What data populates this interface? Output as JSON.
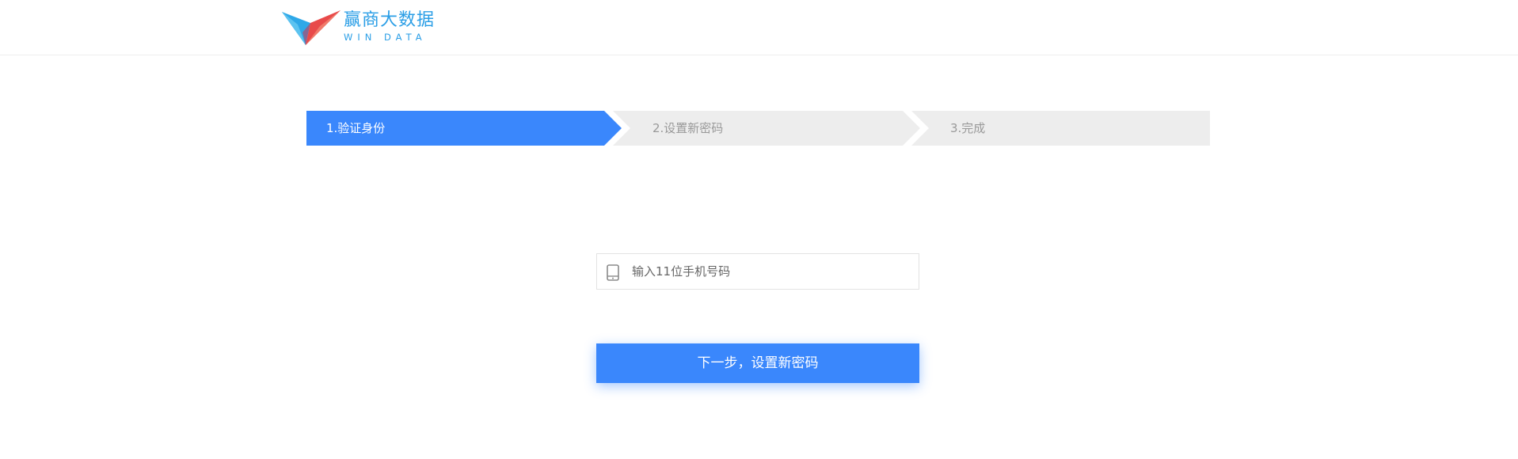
{
  "header": {
    "logo_title": "赢商大数据",
    "logo_subtitle": "WIN DATA"
  },
  "steps": [
    {
      "label": "1.验证身份",
      "state": "active"
    },
    {
      "label": "2.设置新密码",
      "state": "inactive"
    },
    {
      "label": "3.完成",
      "state": "inactive"
    }
  ],
  "form": {
    "phone_placeholder": "输入11位手机号码",
    "phone_value": "",
    "next_label": "下一步，设置新密码"
  },
  "colors": {
    "primary": "#3a87fc",
    "inactive_step": "#ededed",
    "brand_blue": "#2a9ee6",
    "brand_red": "#e84a4a"
  }
}
